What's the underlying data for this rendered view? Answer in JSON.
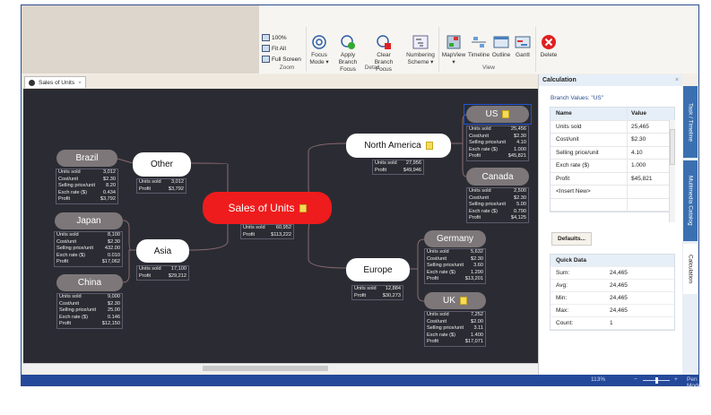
{
  "ribbon": {
    "zoom_group": {
      "label": "Zoom",
      "items": [
        "100%",
        "Fit All",
        "Full Screen"
      ]
    },
    "detail_group": {
      "label": "Detail",
      "buttons": [
        "Focus Mode ▾",
        "Apply Branch Focus",
        "Clear Branch Focus",
        "Numbering Scheme ▾"
      ]
    },
    "view_group": {
      "label": "View",
      "buttons": [
        "MapView ▾",
        "Timeline",
        "Outline",
        "Gantt"
      ]
    },
    "delete_label": "Delete"
  },
  "document_tab": {
    "label": "Sales of Units",
    "close": "×"
  },
  "map": {
    "central": {
      "label": "Sales of Units",
      "rows": [
        [
          "Units sold",
          "60,952"
        ],
        [
          "Profit",
          "$113,222"
        ]
      ]
    },
    "nodes": [
      {
        "label": "Other",
        "rows": [
          [
            "Units sold",
            "3,012"
          ],
          [
            "Profit",
            "$3,792"
          ]
        ]
      },
      {
        "label": "Asia",
        "rows": [
          [
            "Units sold",
            "17,100"
          ],
          [
            "Profit",
            "$29,212"
          ]
        ]
      },
      {
        "label": "North America",
        "note": true,
        "rows": [
          [
            "Units sold",
            "27,956"
          ],
          [
            "Profit",
            "$49,946"
          ]
        ]
      },
      {
        "label": "Europe",
        "rows": [
          [
            "Units sold",
            "12,884"
          ],
          [
            "Profit",
            "$30,273"
          ]
        ]
      },
      {
        "label": "Brazil",
        "rows": [
          [
            "Units sold",
            "3,012"
          ],
          [
            "Cost/unit",
            "$2.30"
          ],
          [
            "Selling price/unit",
            "8.20"
          ],
          [
            "Exch rate ($)",
            "0.434"
          ],
          [
            "Profit",
            "$3,792"
          ]
        ]
      },
      {
        "label": "Japan",
        "rows": [
          [
            "Units sold",
            "8,100"
          ],
          [
            "Cost/unit",
            "$2.30"
          ],
          [
            "Selling price/unit",
            "432.00"
          ],
          [
            "Exch rate ($)",
            "0.010"
          ],
          [
            "Profit",
            "$17,062"
          ]
        ]
      },
      {
        "label": "China",
        "rows": [
          [
            "Units sold",
            "9,000"
          ],
          [
            "Cost/unit",
            "$2.30"
          ],
          [
            "Selling price/unit",
            "25.00"
          ],
          [
            "Exch rate ($)",
            "0.146"
          ],
          [
            "Profit",
            "$12,150"
          ]
        ]
      },
      {
        "label": "US",
        "note": true,
        "selected": true,
        "rows": [
          [
            "Units sold",
            "25,456"
          ],
          [
            "Cost/unit",
            "$2.30"
          ],
          [
            "Selling price/unit",
            "4.10"
          ],
          [
            "Exch rate ($)",
            "1.000"
          ],
          [
            "Profit",
            "$45,821"
          ]
        ]
      },
      {
        "label": "Canada",
        "rows": [
          [
            "Units sold",
            "2,500"
          ],
          [
            "Cost/unit",
            "$2.30"
          ],
          [
            "Selling price/unit",
            "5.00"
          ],
          [
            "Exch rate ($)",
            "0.790"
          ],
          [
            "Profit",
            "$4,125"
          ]
        ]
      },
      {
        "label": "Germany",
        "rows": [
          [
            "Units sold",
            "5,632"
          ],
          [
            "Cost/unit",
            "$2.30"
          ],
          [
            "Selling price/unit",
            "3.60"
          ],
          [
            "Exch rate ($)",
            "1.290"
          ],
          [
            "Profit",
            "$13,201"
          ]
        ]
      },
      {
        "label": "UK",
        "note": true,
        "rows": [
          [
            "Units sold",
            "7,252"
          ],
          [
            "Cost/unit",
            "$2.00"
          ],
          [
            "Selling price/unit",
            "3.11"
          ],
          [
            "Exch rate ($)",
            "1.400"
          ],
          [
            "Profit",
            "$17,071"
          ]
        ]
      }
    ]
  },
  "panel": {
    "title": "Calculation",
    "close": "×",
    "branch_values": "Branch Values: \"US\"",
    "columns": [
      "Name",
      "Value"
    ],
    "rows": [
      [
        "Units sold",
        "25,465"
      ],
      [
        "Cost/unit",
        "$2.30"
      ],
      [
        "Selling price/unit",
        "4.10"
      ],
      [
        "Exch rate ($)",
        "1.000"
      ],
      [
        "Profit",
        "$45,821"
      ],
      [
        "<Insert New>",
        ""
      ],
      [
        "",
        ""
      ]
    ],
    "defaults_button": "Defaults...",
    "quick_data": {
      "title": "Quick Data",
      "rows": [
        [
          "Sum:",
          "24,465"
        ],
        [
          "Avg:",
          "24,465"
        ],
        [
          "Min:",
          "24,465"
        ],
        [
          "Max:",
          "24,465"
        ],
        [
          "Count:",
          "1"
        ]
      ]
    },
    "side_tabs": [
      "Task / Timeline",
      "Multimedia Catalog",
      "Calculation"
    ]
  },
  "status": {
    "zoom": "113%",
    "minus": "−",
    "plus": "+",
    "mode": "Pen Mode",
    "zoom_slider_percent": 50
  },
  "colors": {
    "central": "#ee1c1c",
    "canvas": "#2b2c33",
    "accent": "#25499a",
    "selected": "#1f55d6"
  }
}
